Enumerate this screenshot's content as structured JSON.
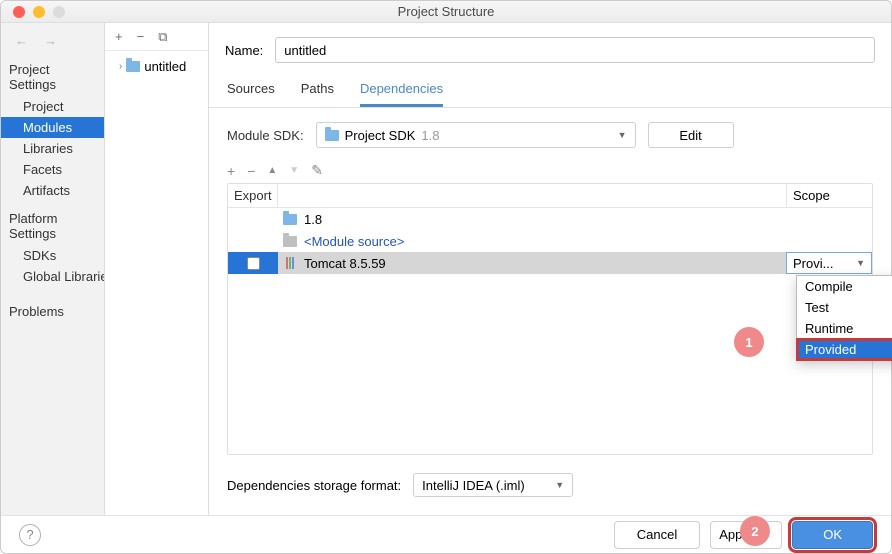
{
  "window": {
    "title": "Project Structure"
  },
  "sidebar": {
    "section1": "Project Settings",
    "items1": [
      "Project",
      "Modules",
      "Libraries",
      "Facets",
      "Artifacts"
    ],
    "section2": "Platform Settings",
    "items2": [
      "SDKs",
      "Global Libraries"
    ],
    "section3": "",
    "items3": [
      "Problems"
    ]
  },
  "mid_tree": {
    "module": "untitled"
  },
  "form": {
    "name_label": "Name:",
    "name_value": "untitled"
  },
  "tabs": [
    "Sources",
    "Paths",
    "Dependencies"
  ],
  "sdk": {
    "label": "Module SDK:",
    "prefix": "Project SDK",
    "suffix": "1.8",
    "edit": "Edit"
  },
  "dep_toolbar_icons": {
    "add": "+",
    "remove": "−",
    "up": "▲",
    "down": "▼",
    "edit": "✎"
  },
  "table": {
    "headers": {
      "export": "Export",
      "scope": "Scope"
    },
    "rows": [
      {
        "icon": "folder",
        "text": "1.8",
        "link": false
      },
      {
        "icon": "folder-grey",
        "text": "<Module source>",
        "link": true
      },
      {
        "icon": "lib",
        "text": "Tomcat 8.5.59",
        "link": false,
        "selected": true,
        "scope": "Provi..."
      }
    ]
  },
  "dropdown": [
    "Compile",
    "Test",
    "Runtime",
    "Provided"
  ],
  "storage": {
    "label": "Dependencies storage format:",
    "value": "IntelliJ IDEA (.iml)"
  },
  "footer": {
    "cancel": "Cancel",
    "apply": "Apply",
    "ok": "OK"
  },
  "callouts": {
    "one": "1",
    "two": "2"
  }
}
